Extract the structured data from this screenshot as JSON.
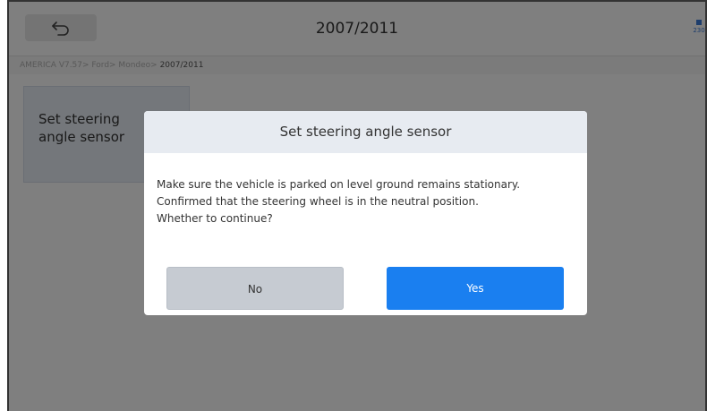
{
  "header": {
    "title": "2007/2011",
    "back_icon": "back-arrow-icon",
    "corner_label": "230"
  },
  "breadcrumb": {
    "path": "AMERICA V7.57> Ford> Mondeo> ",
    "current": "2007/2011"
  },
  "tiles": [
    {
      "label_line1": "Set steering",
      "label_line2": "angle sensor"
    }
  ],
  "dialog": {
    "title": "Set steering angle sensor",
    "message_lines": [
      "Make sure the vehicle is parked on level ground remains stationary.",
      "Confirmed that the steering wheel is in the neutral position.",
      "Whether to continue?"
    ],
    "no_label": "No",
    "yes_label": "Yes"
  },
  "colors": {
    "accent": "#1a7ff0",
    "dialog_header": "#e7ebf1",
    "secondary_button": "#c6cbd2",
    "overlay": "#000000"
  }
}
